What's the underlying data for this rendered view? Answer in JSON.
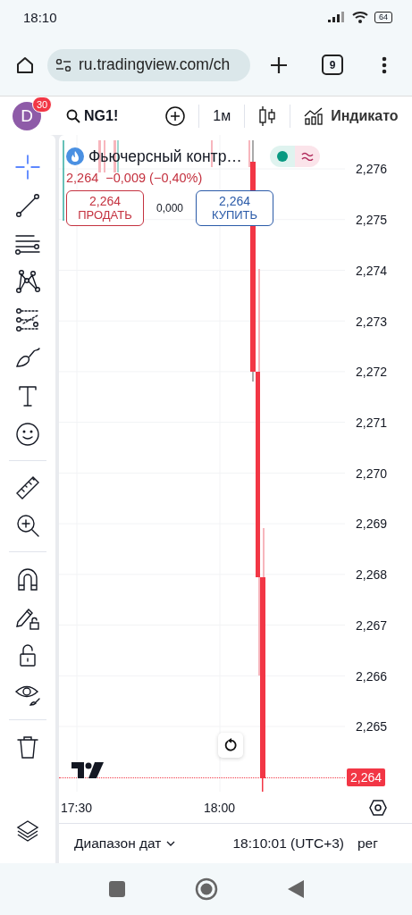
{
  "status_bar": {
    "time": "18:10",
    "battery": "64"
  },
  "browser": {
    "url": "ru.tradingview.com/ch",
    "tab_count": "9"
  },
  "toolbar": {
    "avatar_letter": "D",
    "notification_count": "30",
    "symbol": "NG1!",
    "interval": "1м",
    "indicators_label": "Индикато"
  },
  "tool_groups": [
    [
      {
        "kind": "crosshair",
        "selected": true
      },
      {
        "kind": "trend-line",
        "selected": false
      },
      {
        "kind": "fib",
        "selected": false
      },
      {
        "kind": "pattern",
        "selected": false
      },
      {
        "kind": "forecast",
        "selected": false
      },
      {
        "kind": "brush",
        "selected": false
      },
      {
        "kind": "text",
        "selected": false
      },
      {
        "kind": "emoji",
        "selected": false
      }
    ],
    [
      {
        "kind": "ruler",
        "selected": false
      },
      {
        "kind": "zoom",
        "selected": false
      }
    ],
    [
      {
        "kind": "magnet",
        "selected": false
      },
      {
        "kind": "lock-drawing",
        "selected": false
      },
      {
        "kind": "lock",
        "selected": false
      },
      {
        "kind": "eye",
        "selected": false
      }
    ],
    [
      {
        "kind": "trash",
        "selected": false
      }
    ]
  ],
  "legend": {
    "title": "Фьючерсный контр…",
    "last": "2,264",
    "change": "−0,009 (−0,40%)",
    "sell": {
      "price": "2,264",
      "label": "ПРОДАТЬ"
    },
    "spread": "0,000",
    "buy": {
      "price": "2,264",
      "label": "КУПИТЬ"
    }
  },
  "price_scale": [
    "2,276",
    "2,275",
    "2,274",
    "2,273",
    "2,272",
    "2,271",
    "2,270",
    "2,269",
    "2,268",
    "2,267",
    "2,266",
    "2,265"
  ],
  "last_price_label": "2,264",
  "time_scale": [
    "17:30",
    "18:00"
  ],
  "bottom_bar": {
    "date_range": "Диапазон дат",
    "clock": "18:10:01 (UTC+3)",
    "session": "рег"
  }
}
